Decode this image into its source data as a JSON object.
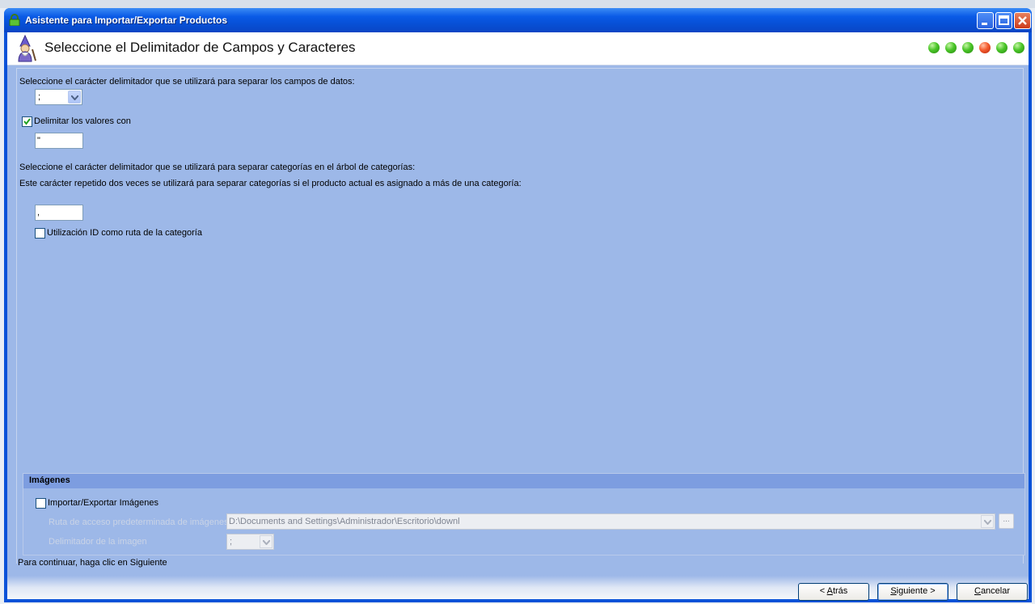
{
  "window": {
    "title": "Asistente para Importar/Exportar Productos"
  },
  "header": {
    "title": "Seleccione el Delimitador de Campos y Caracteres",
    "steps": [
      "done",
      "done",
      "done",
      "current",
      "done",
      "done"
    ]
  },
  "fields": {
    "field_delimiter_label": "Seleccione el carácter delimitador que se utilizará para separar los campos de datos:",
    "field_delimiter_value": ";",
    "delimit_values_label": "Delimitar los valores con",
    "delimit_values_checked": true,
    "delimit_values_value": "\"",
    "category_delimiter_label": "Seleccione el carácter delimitador que se utilizará para separar categorías en el árbol de categorías:",
    "category_repeat_label": "Este carácter repetido dos veces se utilizará para separar categorías si el producto actual es asignado a más de una categoría:",
    "category_delimiter_value": ",",
    "use_id_label": "Utilización ID como ruta de la categoría",
    "use_id_checked": false
  },
  "images": {
    "group_title": "Imágenes",
    "import_export_label": "Importar/Exportar Imágenes",
    "import_export_checked": false,
    "path_label": "Ruta de acceso predeterminada de imágenes",
    "path_value": "D:\\Documents and Settings\\Administrador\\Escritorio\\downl",
    "browse_label": "...",
    "image_delimiter_label": "Delimitador de la imagen",
    "image_delimiter_value": ";"
  },
  "status": {
    "hint": "Para continuar, haga clic en Siguiente"
  },
  "buttons": {
    "back_prefix": "< ",
    "back_key": "A",
    "back_rest": "trás",
    "next_key": "S",
    "next_rest": "iguiente >",
    "cancel_key": "C",
    "cancel_rest": "ancelar"
  },
  "colors": {
    "titlebar": "#0a5ae6",
    "client_bg": "#9db8e8",
    "group_header": "#7d9de0",
    "step_done": "#49c527",
    "step_current": "#f45a2c"
  }
}
